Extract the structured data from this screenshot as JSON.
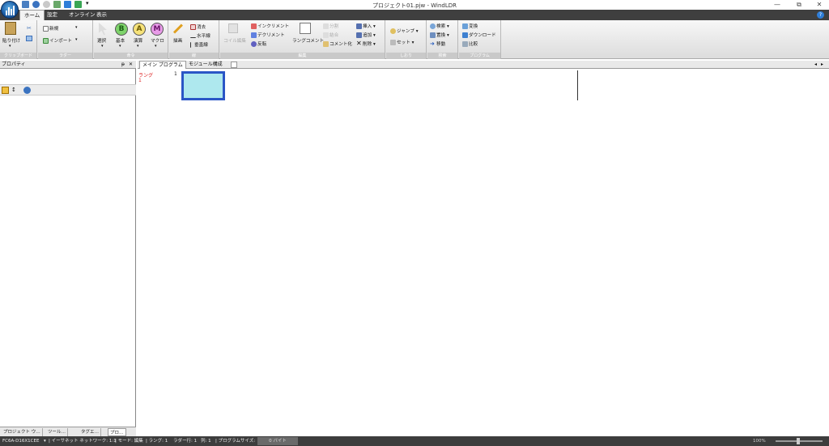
{
  "window": {
    "title": "プロジェクト01.pjw - WindLDR",
    "minimize": "—",
    "restore": "⧉",
    "close": "✕"
  },
  "tabs": [
    "ホーム",
    "設定",
    "オンライン",
    "表示"
  ],
  "ribbon": {
    "clipboard": {
      "label": "クリップボード",
      "paste": "貼り付け"
    },
    "ladder": {
      "label": "ラダー",
      "new": "新規",
      "import": "インポート"
    },
    "instruction": {
      "label": "命令",
      "select": "選択",
      "basic": "基本",
      "advanced": "演算",
      "macro": "マクロ"
    },
    "draw": {
      "label": "線",
      "draw": "描画",
      "erase": "消去",
      "horizontal": "水平線",
      "vertical": "垂直線"
    },
    "edit": {
      "label": "編集",
      "coil_edit": "コイル編集",
      "increment": "インクリメント",
      "decrement": "デクリメント",
      "invert": "反転",
      "rung_comment": "ラングコメント",
      "split": "分割",
      "join": "結合",
      "comment_out": "コメント化",
      "insert": "挿入",
      "add": "追加",
      "delete": "削除"
    },
    "bookmark": {
      "label": "しおり",
      "jump": "ジャンプ",
      "set": "セット"
    },
    "search": {
      "label": "検索",
      "search": "検索",
      "replace": "置換",
      "move": "移動"
    },
    "program": {
      "label": "プログラム",
      "convert": "変換",
      "download": "ダウンロード",
      "compare": "比較"
    }
  },
  "panel": {
    "title": "プロパティ",
    "pin": "ᵽ",
    "close": "✕"
  },
  "bottom_tabs": [
    "プロジェクト ウ…",
    "ツール…",
    "タグエ…",
    "プロ…"
  ],
  "doc_tabs": [
    "メイン プログラム",
    "モジュール構成"
  ],
  "ladder": {
    "rung_label": "ラング",
    "rung_number": "1",
    "line_number": "1"
  },
  "status": {
    "plc": "FC6A-D16X1CEE",
    "comm": "| イーサネット  ネットワーク: 1:1",
    "mode": "| モード: 編集",
    "rung": "| ラング: 1",
    "ladder_row": "ラダー行: 1",
    "column": "列: 1",
    "program_size": "| プログラムサイズ:",
    "bytes": "0 バイト",
    "zoom": "100%"
  }
}
